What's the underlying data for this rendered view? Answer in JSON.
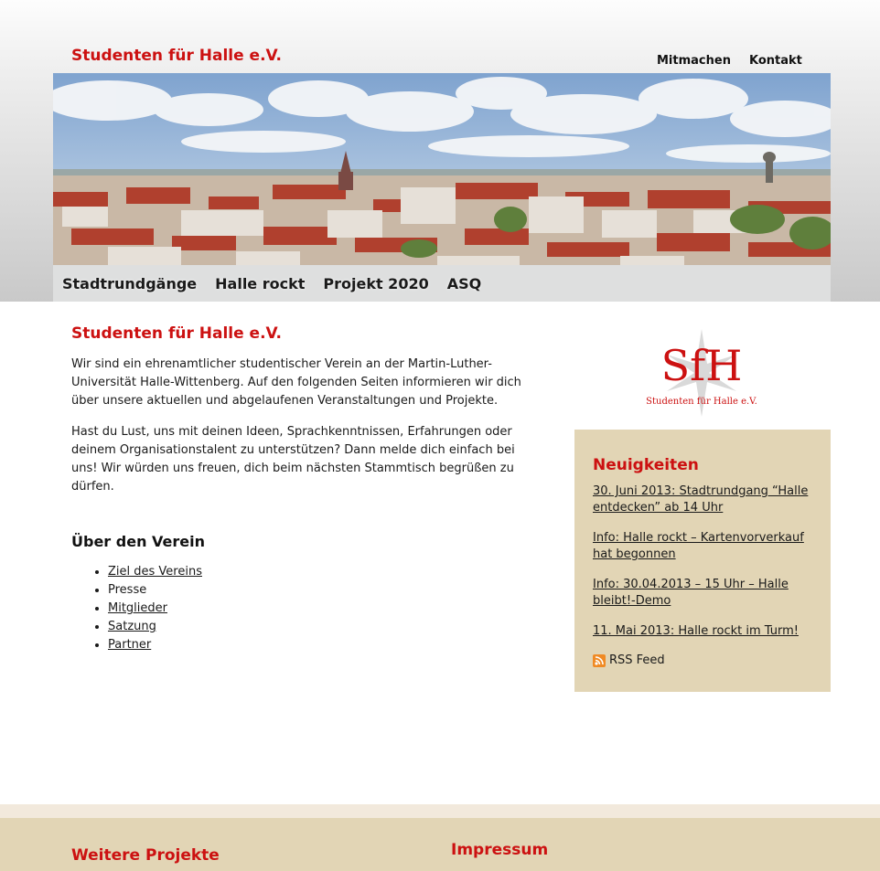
{
  "header": {
    "site_title": "Studenten für Halle e.V.",
    "top_nav": [
      "Mitmachen",
      "Kontakt"
    ],
    "main_nav": [
      "Stadtrundgänge",
      "Halle rockt",
      "Projekt 2020",
      "ASQ"
    ]
  },
  "content": {
    "title": "Studenten für Halle e.V.",
    "paragraph1": "Wir sind ein ehrenamtlicher studentischer Verein an der Martin-Luther-Universität Halle-Wittenberg. Auf den folgenden Seiten informieren wir dich über unsere aktuellen und abgelaufenen Veranstaltungen und Projekte.",
    "paragraph2": "Hast du Lust, uns mit deinen Ideen, Sprachkenntnissen, Erfahrungen oder deinem Organisationstalent zu unterstützen? Dann melde dich einfach bei uns! Wir würden uns freuen, dich beim nächsten Stammtisch begrüßen zu dürfen.",
    "about_heading": "Über den Verein",
    "about_links": [
      {
        "label": "Ziel des Vereins",
        "link": true
      },
      {
        "label": "Presse",
        "link": false
      },
      {
        "label": "Mitglieder",
        "link": true
      },
      {
        "label": "Satzung",
        "link": true
      },
      {
        "label": "Partner",
        "link": true
      }
    ]
  },
  "logo": {
    "letters": "SfH",
    "subtitle": "Studenten für Halle e.V."
  },
  "news": {
    "heading": "Neuigkeiten",
    "items": [
      "30. Juni 2013: Stadtrundgang “Halle entdecken” ab 14 Uhr",
      "Info: Halle rockt – Kartenvorverkauf hat begonnen",
      "Info: 30.04.2013 – 15 Uhr – Halle bleibt!-Demo",
      "11. Mai 2013: Halle rockt im Turm!"
    ],
    "rss_label": "RSS Feed",
    "rss_icon": "rss-icon"
  },
  "footer": {
    "projects_heading": "Weitere Projekte",
    "impressum_heading": "Impressum"
  },
  "colors": {
    "accent": "#cc1111",
    "panel": "#e2d5b5",
    "footer_stripe": "#f2e9dc"
  }
}
